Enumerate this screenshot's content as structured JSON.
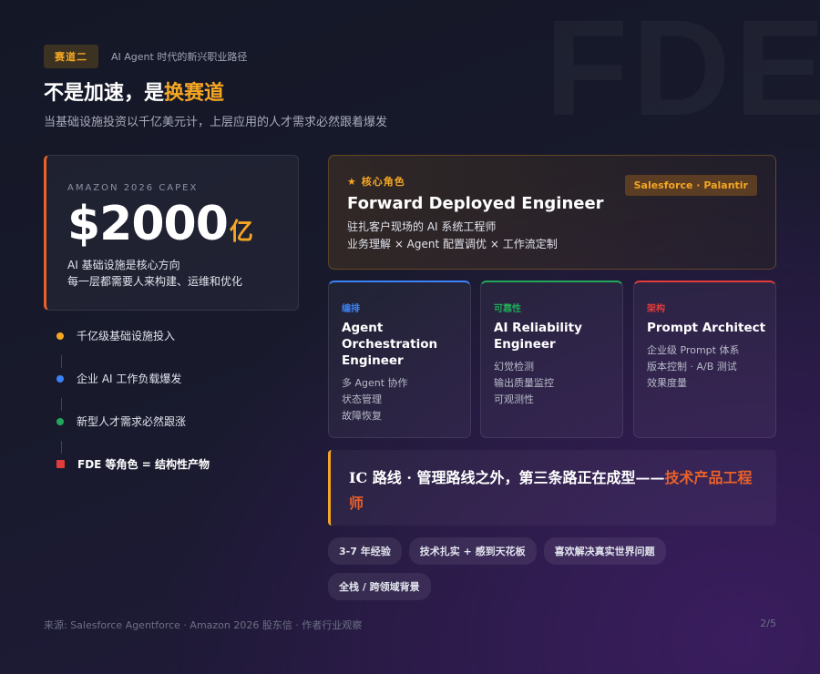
{
  "watermark": "FDE",
  "header": {
    "track_badge": "赛道二",
    "track_subtitle": "AI Agent 时代的新兴职业路径",
    "title_prefix": "不是加速，是",
    "title_accent": "换赛道",
    "subtitle": "当基础设施投资以千亿美元计，上层应用的人才需求必然跟着爆发"
  },
  "capex": {
    "label": "AMAZON 2026 CAPEX",
    "value": "$2000",
    "unit": "亿",
    "desc_line1": "AI 基础设施是核心方向",
    "desc_line2": "每一层都需要人来构建、运维和优化"
  },
  "steps": [
    {
      "text": "千亿级基础设施投入",
      "color": "#f5a623"
    },
    {
      "text": "企业 AI 工作负载爆发",
      "color": "#3b82f6"
    },
    {
      "text": "新型人才需求必然跟涨",
      "color": "#22a85a"
    },
    {
      "text": "FDE 等角色 = 结构性产物",
      "color": "#e23b3b"
    }
  ],
  "hero": {
    "tag": "★ 核心角色",
    "title": "Forward Deployed Engineer",
    "desc_line1": "驻扎客户现场的 AI 系统工程师",
    "desc_line2": "业务理解 × Agent 配置调优 × 工作流定制",
    "companies": "Salesforce · Palantir"
  },
  "roles": [
    {
      "category": "编排",
      "accent": "#3b82f6",
      "name": "Agent Orchestration Engineer",
      "points": [
        "多 Agent 协作",
        "状态管理",
        "故障恢复"
      ]
    },
    {
      "category": "可靠性",
      "accent": "#22a85a",
      "name": "AI Reliability Engineer",
      "points": [
        "幻觉检测",
        "输出质量监控",
        "可观测性"
      ]
    },
    {
      "category": "架构",
      "accent": "#e23b3b",
      "name": "Prompt Architect",
      "points": [
        "企业级 Prompt 体系",
        "版本控制 · A/B 测试",
        "效果度量"
      ]
    }
  ],
  "callout": {
    "text": "IC 路线 · 管理路线之外，第三条路正在成型——",
    "highlight": "技术产品工程师"
  },
  "chips": [
    "3-7 年经验",
    "技术扎实 + 感到天花板",
    "喜欢解决真实世界问题",
    "全栈 / 跨领域背景"
  ],
  "footer": {
    "source": "来源: Salesforce Agentforce · Amazon 2026 股东信 · 作者行业观察",
    "page": "2/5"
  }
}
